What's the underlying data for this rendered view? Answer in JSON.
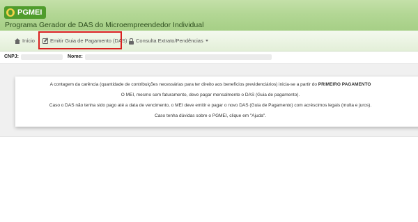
{
  "header": {
    "logo_text": "PGMEI",
    "app_title": "Programa Gerador de DAS do Microempreendedor Individual"
  },
  "nav": {
    "items": [
      {
        "label": "Início",
        "icon": "home-icon"
      },
      {
        "label": "Emitir Guia de Pagamento (DAS)",
        "icon": "edit-icon"
      },
      {
        "label": "Consulta Extrato/Pendências",
        "icon": "lock-icon"
      }
    ]
  },
  "info": {
    "cnpj_label": "CNPJ:",
    "name_label": "Nome:"
  },
  "notice": {
    "line1_prefix": "A contagem da carência (quantidade de contribuições necessárias para ter direito aos benefícios previdenciários) inicia-se a partir do ",
    "line1_bold": "PRIMEIRO PAGAMENTO",
    "line2": "O MEI, mesmo sem faturamento, deve pagar mensalmente o DAS (Guia de pagamento).",
    "line3": "Caso o DAS não tenha sido pago até a data de vencimento, o MEI deve emitir e pagar o novo DAS (Guia de Pagamento) com acréscimos legais (multa e juros).",
    "line4": "Caso tenha dúvidas sobre o PGMEI, clique em \"Ajuda\"."
  },
  "colors": {
    "header_green": "#b3d795",
    "logo_green": "#4f9c2c",
    "highlight_red": "#d9201f"
  }
}
